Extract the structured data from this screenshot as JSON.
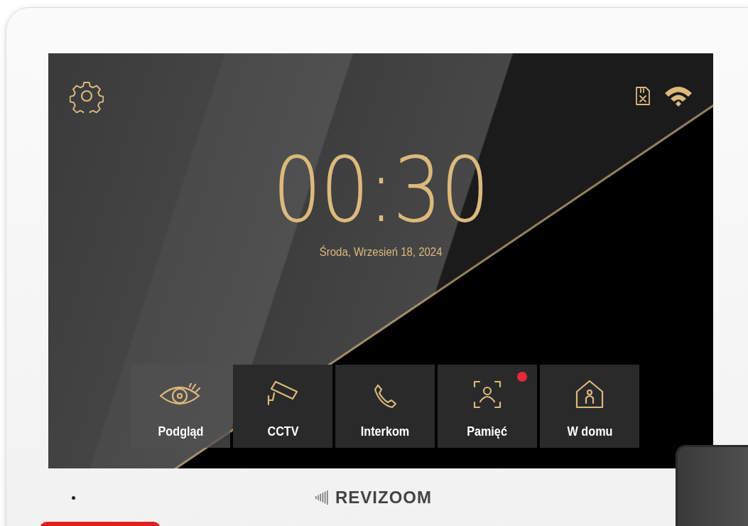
{
  "device": {
    "brand": "REVIZOOM"
  },
  "screen": {
    "time": "00:30",
    "date": "Środa, Wrzesień 18, 2024",
    "tiles": [
      {
        "kind": "eye",
        "label": "Podgląd",
        "has_notification": false
      },
      {
        "kind": "camera",
        "label": "CCTV",
        "has_notification": false
      },
      {
        "kind": "phone",
        "label": "Interkom",
        "has_notification": false
      },
      {
        "kind": "person",
        "label": "Pamięć",
        "has_notification": true
      },
      {
        "kind": "home",
        "label": "W domu",
        "has_notification": false
      }
    ]
  }
}
